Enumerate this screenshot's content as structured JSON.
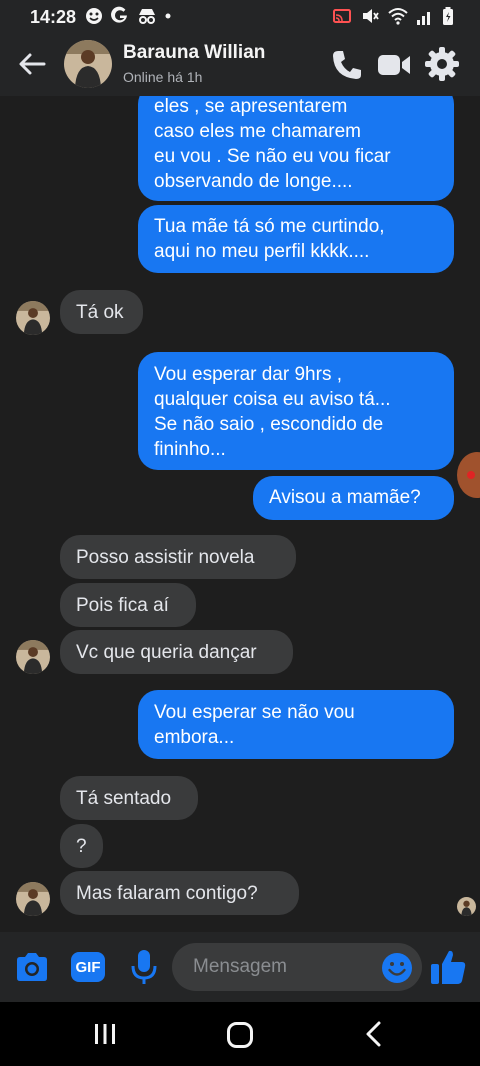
{
  "status_bar": {
    "time": "14:28"
  },
  "header": {
    "contact_name": "Barauna Willian",
    "contact_status": "Online há 1h"
  },
  "messages": {
    "m1": {
      "text": "eles , se apresentarem\ncaso eles me chamarem\neu vou . Se não eu vou ficar\nobservando de longe...."
    },
    "m2": {
      "text": "Tua mãe tá só me curtindo,\naqui no meu perfil kkkk...."
    },
    "m3": {
      "text": "Tá ok"
    },
    "m4": {
      "text": "Vou esperar dar 9hrs ,\nqualquer coisa eu aviso tá...\nSe não saio ,  escondido de\nfininho..."
    },
    "m5": {
      "text": "Avisou a mamãe?"
    },
    "m6": {
      "text": "Posso assistir novela"
    },
    "m7": {
      "text": "Pois fica aí"
    },
    "m8": {
      "text": "Vc que queria dançar"
    },
    "m9": {
      "text": "Vou esperar se não vou\nembora..."
    },
    "m10": {
      "text": "Tá sentado"
    },
    "m11": {
      "text": "?"
    },
    "m12": {
      "text": "Mas falaram contigo?"
    }
  },
  "composer": {
    "gif_label": "GIF",
    "placeholder": "Mensagem"
  },
  "colors": {
    "outgoing_bubble": "#1877f2",
    "incoming_bubble": "#3a3b3c",
    "accent": "#1877f2",
    "background": "#1e1e1e"
  }
}
